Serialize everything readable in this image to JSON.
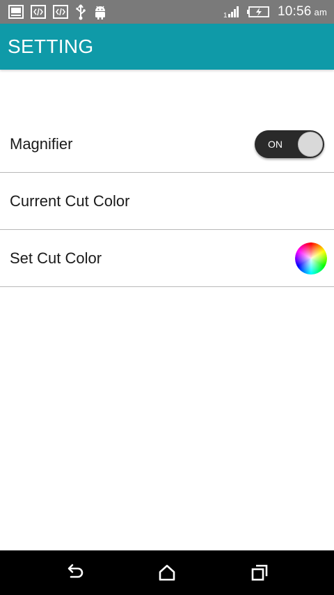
{
  "status_bar": {
    "time": "10:56",
    "ampm": "am",
    "left_icons": [
      "gallery-icon",
      "code-icon",
      "code-icon",
      "usb-icon",
      "android-icon"
    ],
    "right_icons": [
      "signal-icon",
      "battery-charging-icon"
    ]
  },
  "app_bar": {
    "title": "SETTING",
    "color": "#0f9aa8"
  },
  "settings": {
    "magnifier": {
      "label": "Magnifier",
      "toggle_text": "ON"
    },
    "current_cut_color": {
      "label": "Current Cut Color"
    },
    "set_cut_color": {
      "label": "Set Cut Color",
      "icon": "color-wheel-icon"
    }
  },
  "nav_bar": {
    "buttons": [
      "back-icon",
      "home-icon",
      "recents-icon"
    ]
  }
}
